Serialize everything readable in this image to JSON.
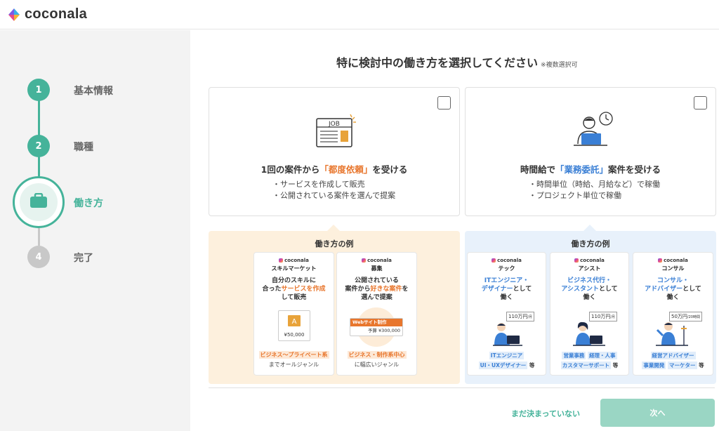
{
  "header": {
    "brand": "coconala"
  },
  "steps": [
    {
      "num": "1",
      "label": "基本情報"
    },
    {
      "num": "2",
      "label": "職種"
    },
    {
      "num": "3",
      "label": "働き方"
    },
    {
      "num": "4",
      "label": "完了"
    }
  ],
  "title": {
    "main": "特に検討中の働き方を選択してください",
    "note": "※複数選択可"
  },
  "options": [
    {
      "icon": "job-listing-icon",
      "title_pre": "1回の案件から",
      "title_hl": "「都度依頼」",
      "title_post": "を受ける",
      "bullets": [
        "・サービスを作成して販売",
        "・公開されている案件を選んで提案"
      ],
      "icon_text": "JOB"
    },
    {
      "icon": "person-laptop-clock-icon",
      "title_pre": "時間給で",
      "title_hl": "「業務委託」",
      "title_post": "案件を受ける",
      "bullets": [
        "・時間単位（時給、月給など）で稼働",
        "・プロジェクト単位で稼働"
      ]
    }
  ],
  "examples_title": "働き方の例",
  "examples_left": [
    {
      "brand": "coconala",
      "name": "スキルマーケット",
      "desc1": "自分のスキルに",
      "desc2a": "合った",
      "desc2b": "サービスを作成",
      "desc3": "して販売",
      "price": "¥50,000",
      "tag": "ビジネス〜プライベート系",
      "sub": "までオールジャンル"
    },
    {
      "brand": "coconala",
      "name": "募集",
      "desc1": "公開されている",
      "desc2a": "案件から",
      "desc2b": "好きな案件",
      "desc2c": "を",
      "desc3": "選んで提案",
      "job_label": "Webサイト制作",
      "budget": "予算 ¥300,000",
      "tag": "ビジネス・制作系中心",
      "sub": "に幅広いジャンル"
    }
  ],
  "examples_right": [
    {
      "brand": "coconala",
      "name": "テック",
      "desc1": "ITエンジニア・",
      "desc2": "デザイナー",
      "desc2b": "として",
      "desc3": "働く",
      "price": "110万円",
      "price_unit": "/月",
      "tags_line1": [
        "ITエンジニア"
      ],
      "tags_line2": [
        "UI・UXデザイナー"
      ],
      "suffix": "等"
    },
    {
      "brand": "coconala",
      "name": "アシスト",
      "desc1": "ビジネス代行・",
      "desc2": "アシスタント",
      "desc2b": "として",
      "desc3": "働く",
      "price": "110万円",
      "price_unit": "/月",
      "tags_line1": [
        "営業事務",
        "経理・人事"
      ],
      "tags_line2": [
        "カスタマーサポート"
      ],
      "suffix": "等"
    },
    {
      "brand": "coconala",
      "name": "コンサル",
      "desc1": "コンサル・",
      "desc2": "アドバイザー",
      "desc2b": "として",
      "desc3": "働く",
      "price": "50万円",
      "price_unit": "/20時間",
      "tags_line1": [
        "経営アドバイザー"
      ],
      "tags_line2": [
        "事業開発",
        "マーケター"
      ],
      "suffix": "等"
    }
  ],
  "footer": {
    "undecided": "まだ決まっていない",
    "next": "次へ"
  },
  "colors": {
    "accent": "#45b39a",
    "orange": "#e8762d",
    "blue": "#3a7fd5",
    "orange_bg": "#fdf0dd",
    "blue_bg": "#e8f1fb"
  }
}
